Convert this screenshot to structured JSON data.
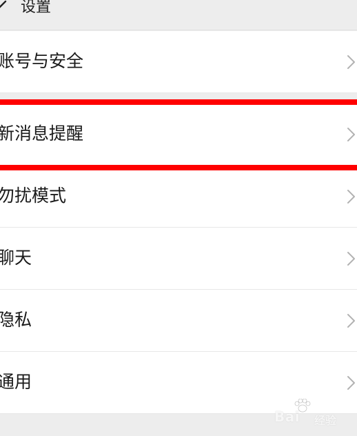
{
  "header": {
    "title": "设置",
    "back_icon": "back-arrow-icon"
  },
  "settings_items": [
    {
      "label": "账号与安全",
      "icon": "chevron-right-icon"
    },
    {
      "label": "新消息提醒",
      "icon": "chevron-right-icon",
      "highlighted": true
    },
    {
      "label": "勿扰模式",
      "icon": "chevron-right-icon"
    },
    {
      "label": "聊天",
      "icon": "chevron-right-icon"
    },
    {
      "label": "隐私",
      "icon": "chevron-right-icon"
    },
    {
      "label": "通用",
      "icon": "chevron-right-icon"
    }
  ],
  "colors": {
    "background": "#ededed",
    "row": "#ffffff",
    "highlight": "#ff0000",
    "chevron": "#b2b2b2"
  },
  "watermark": {
    "text": "Bai",
    "subtext": "经验",
    "icon": "baidu-paw-icon"
  }
}
